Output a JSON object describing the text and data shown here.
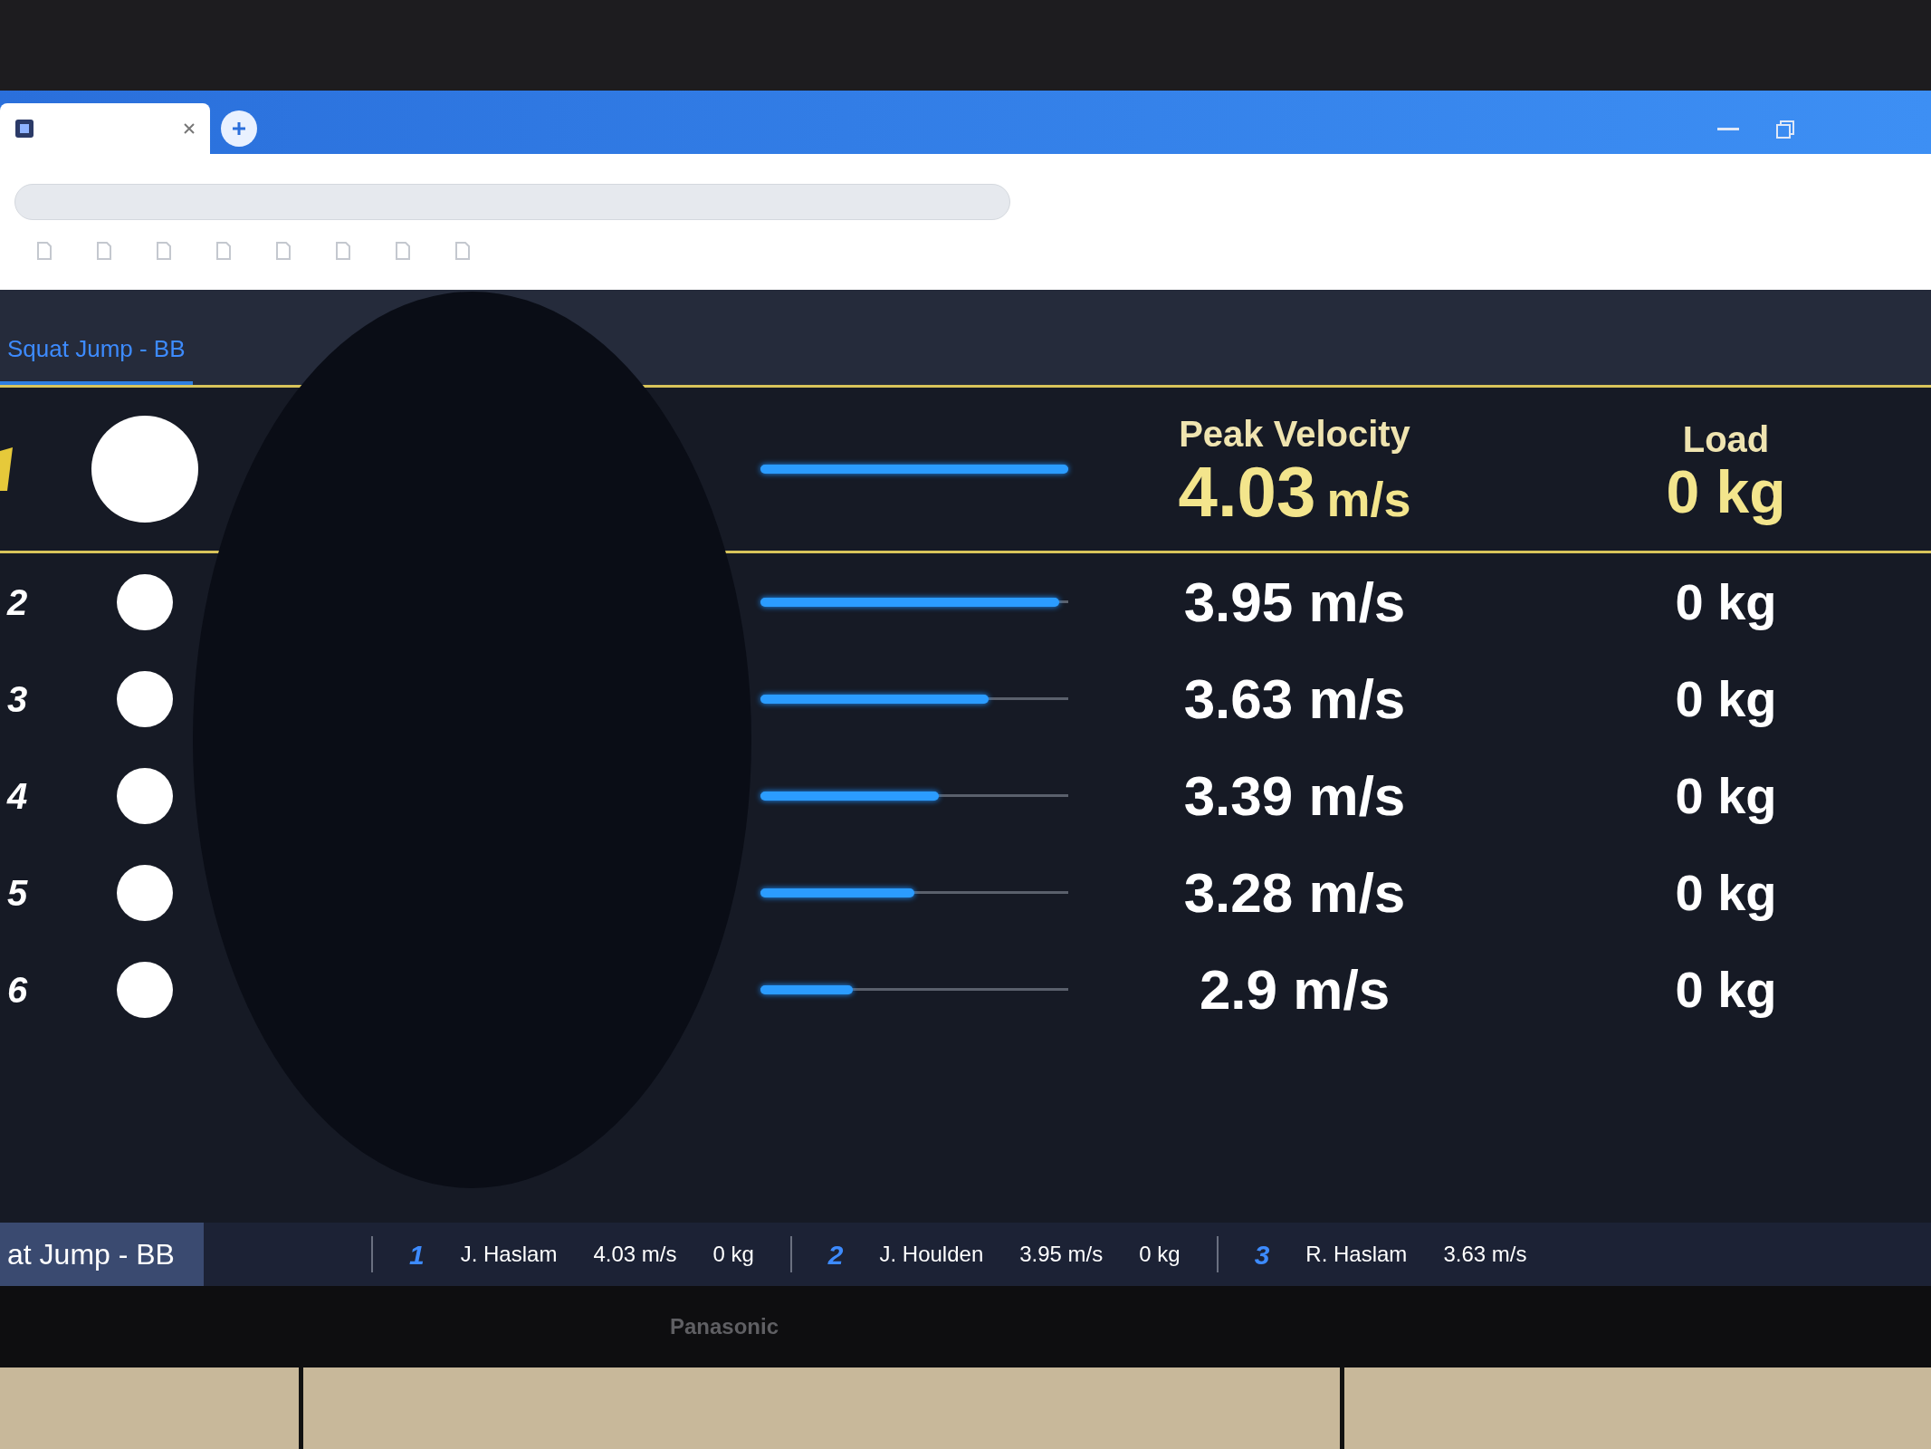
{
  "app": {
    "tabs": [
      {
        "label": "Squat Jump - BB",
        "selected": true
      }
    ]
  },
  "leaderboard": {
    "headers": {
      "velocity": "Peak Velocity",
      "load": "Load"
    },
    "leader": {
      "velocity_value": "4.03",
      "velocity_unit": "m/s",
      "load": "0 kg",
      "level": 1
    },
    "rows": [
      {
        "rank": "2",
        "velocity": "3.95 m/s",
        "load": "0 kg",
        "level": 0.97
      },
      {
        "rank": "3",
        "velocity": "3.63 m/s",
        "load": "0 kg",
        "level": 0.74
      },
      {
        "rank": "4",
        "velocity": "3.39 m/s",
        "load": "0 kg",
        "level": 0.58
      },
      {
        "rank": "5",
        "velocity": "3.28 m/s",
        "load": "0 kg",
        "level": 0.5
      },
      {
        "rank": "6",
        "velocity": "2.9 m/s",
        "load": "0 kg",
        "level": 0.3
      }
    ]
  },
  "footer": {
    "exercise": "at Jump - BB",
    "ticker": [
      {
        "rank": "1",
        "name": "J. Haslam",
        "velocity": "4.03 m/s",
        "load": "0 kg"
      },
      {
        "rank": "2",
        "name": "J. Houlden",
        "velocity": "3.95 m/s",
        "load": "0 kg"
      },
      {
        "rank": "3",
        "name": "R. Haslam",
        "velocity": "3.63 m/s"
      }
    ]
  },
  "tv": {
    "brand": "Panasonic"
  }
}
